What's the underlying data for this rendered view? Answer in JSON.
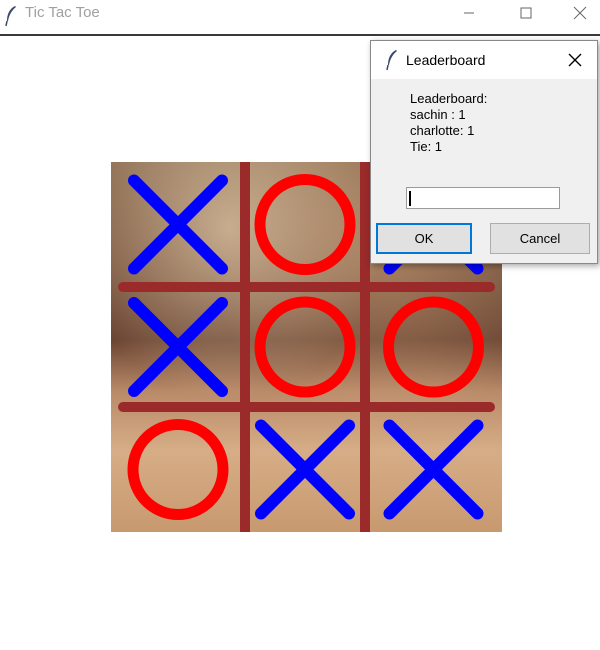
{
  "window": {
    "title": "Tic Tac Toe",
    "icon": "feather-icon",
    "controls": [
      "minimize-icon",
      "maximize-icon",
      "close-icon"
    ]
  },
  "board": {
    "cells": [
      [
        "X",
        "O",
        "X"
      ],
      [
        "X",
        "O",
        "O"
      ],
      [
        "O",
        "X",
        "X"
      ]
    ],
    "colors": {
      "x": "#0000ff",
      "o": "#ff0000",
      "grid": "#9b2a2a"
    }
  },
  "dialog": {
    "title": "Leaderboard",
    "message_lines": [
      "Leaderboard:",
      "sachin : 1",
      "charlotte: 1",
      "Tie: 1"
    ],
    "entry_value": "",
    "ok_label": "OK",
    "cancel_label": "Cancel"
  }
}
